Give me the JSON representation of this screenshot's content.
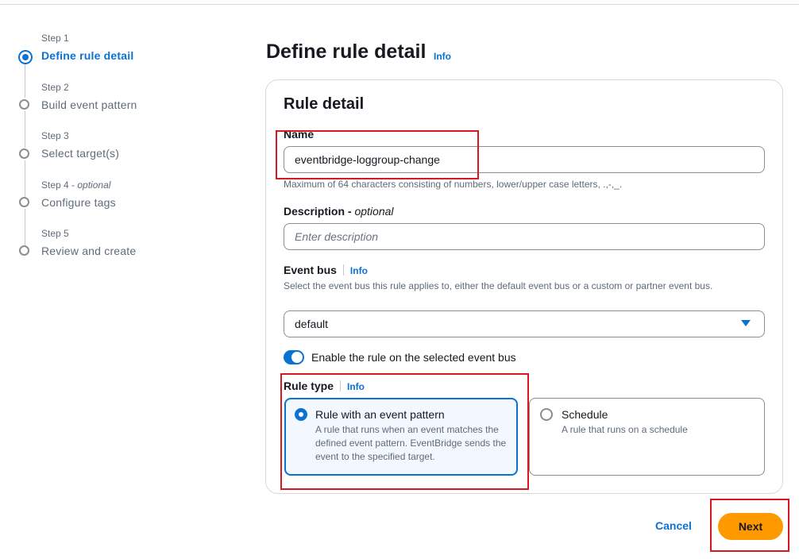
{
  "steps": [
    {
      "small": "Step 1",
      "label": "Define rule detail"
    },
    {
      "small": "Step 2",
      "label": "Build event pattern"
    },
    {
      "small": "Step 3",
      "label": "Select target(s)"
    },
    {
      "small": "Step 4",
      "small_optional": "optional",
      "label": "Configure tags"
    },
    {
      "small": "Step 5",
      "label": "Review and create"
    }
  ],
  "page": {
    "title": "Define rule detail",
    "info": "Info"
  },
  "card": {
    "title": "Rule detail"
  },
  "name": {
    "label": "Name",
    "value": "eventbridge-loggroup-change",
    "hint": "Maximum of 64 characters consisting of numbers, lower/upper case letters, .,-,_."
  },
  "description": {
    "label": "Description",
    "optional": "optional",
    "placeholder": "Enter description"
  },
  "event_bus": {
    "label": "Event bus",
    "info": "Info",
    "hint": "Select the event bus this rule applies to, either the default event bus or a custom or partner event bus.",
    "value": "default"
  },
  "toggle": {
    "label": "Enable the rule on the selected event bus",
    "on": true
  },
  "rule_type": {
    "label": "Rule type",
    "info": "Info",
    "options": [
      {
        "title": "Rule with an event pattern",
        "desc": "A rule that runs when an event matches the defined event pattern. EventBridge sends the event to the specified target.",
        "selected": true
      },
      {
        "title": "Schedule",
        "desc": "A rule that runs on a schedule",
        "selected": false
      }
    ]
  },
  "footer": {
    "cancel": "Cancel",
    "next": "Next"
  },
  "colors": {
    "accent": "#0972d3",
    "primary_button": "#ff9900",
    "annotation": "#d7191f"
  }
}
